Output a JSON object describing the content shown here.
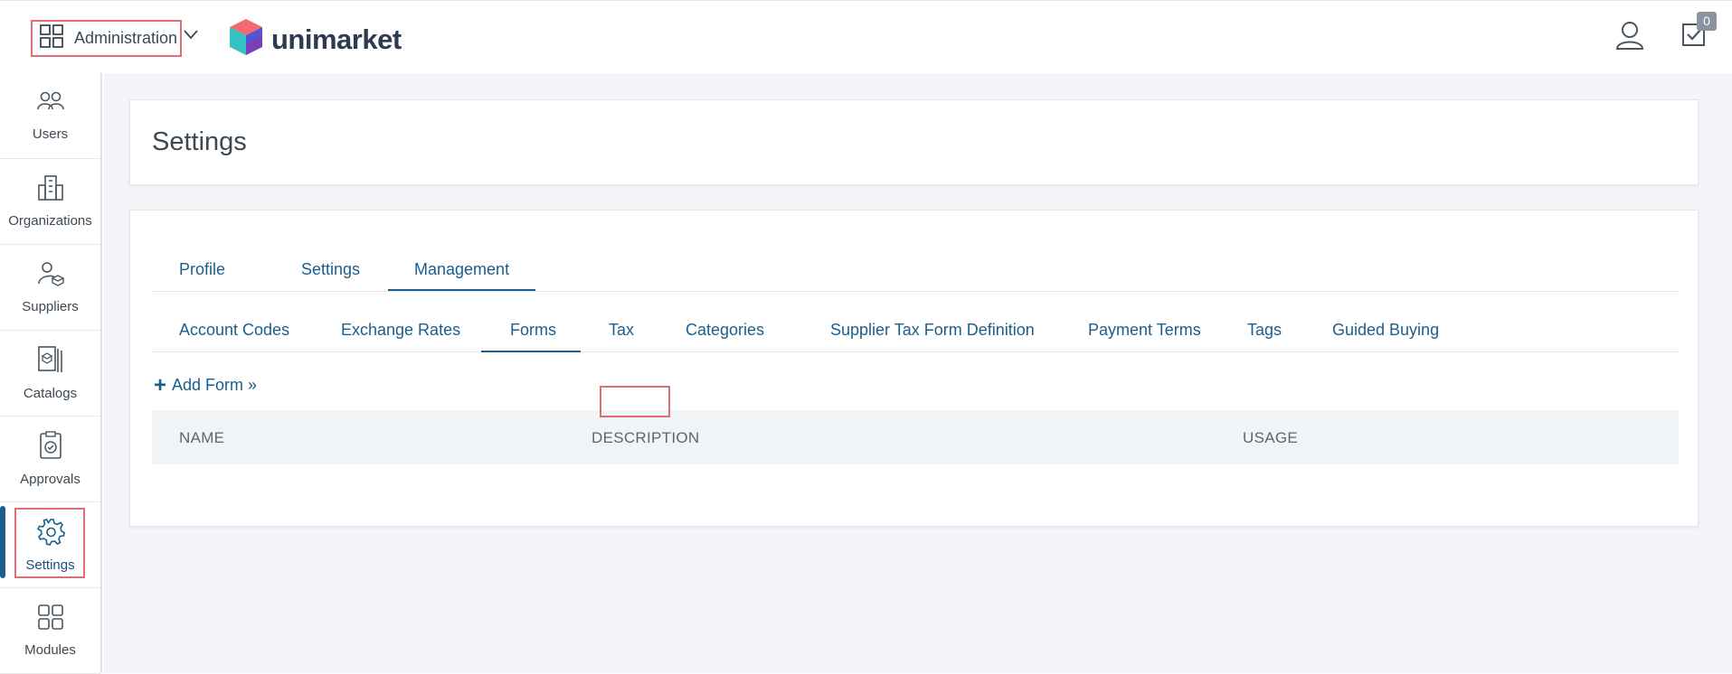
{
  "header": {
    "module_label": "Administration",
    "brand_name": "unimarket",
    "tasks_count": "0",
    "accent_color": "#1b5e8c"
  },
  "sidebar": {
    "items": [
      {
        "label": "Users",
        "icon": "users-icon"
      },
      {
        "label": "Organizations",
        "icon": "building-icon"
      },
      {
        "label": "Suppliers",
        "icon": "supplier-icon"
      },
      {
        "label": "Catalogs",
        "icon": "catalog-icon"
      },
      {
        "label": "Approvals",
        "icon": "approval-icon"
      },
      {
        "label": "Settings",
        "icon": "gear-icon",
        "active": true
      },
      {
        "label": "Modules",
        "icon": "grid-icon"
      }
    ]
  },
  "page": {
    "title": "Settings"
  },
  "tabs": [
    {
      "label": "Profile"
    },
    {
      "label": "Settings"
    },
    {
      "label": "Management",
      "active": true
    }
  ],
  "subtabs": [
    {
      "label": "Account Codes"
    },
    {
      "label": "Exchange Rates"
    },
    {
      "label": "Forms",
      "active": true
    },
    {
      "label": "Tax"
    },
    {
      "label": "Categories"
    },
    {
      "label": "Supplier Tax Form Definition"
    },
    {
      "label": "Payment Terms"
    },
    {
      "label": "Tags"
    },
    {
      "label": "Guided Buying"
    }
  ],
  "add_form": {
    "label": "Add Form »"
  },
  "table": {
    "columns": [
      "NAME",
      "DESCRIPTION",
      "USAGE"
    ]
  }
}
